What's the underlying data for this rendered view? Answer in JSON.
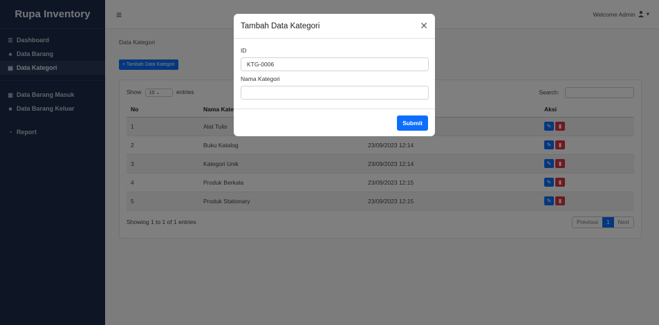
{
  "app": {
    "title": "Rupa Inventory"
  },
  "sidebar": {
    "items": [
      {
        "label": "Dashboard",
        "icon": "dashboard-icon"
      },
      {
        "label": "Data Barang",
        "icon": "boxes-icon"
      },
      {
        "label": "Data Kategori",
        "icon": "category-icon",
        "active": true
      },
      {
        "label": "Data Barang Masuk",
        "icon": "incoming-icon"
      },
      {
        "label": "Data Barang Keluar",
        "icon": "truck-icon"
      },
      {
        "label": "Report",
        "icon": "chart-icon"
      }
    ]
  },
  "topbar": {
    "welcome": "Welcome Admin"
  },
  "page": {
    "breadcrumb": "Data Kategori",
    "add_button": "+ Tambah Data Kategori"
  },
  "table": {
    "show_label": "Show",
    "show_value": "10",
    "entries_label": "entries",
    "search_label": "Search:",
    "headers": {
      "no": "No",
      "nama": "Nama Kategori",
      "tanggal": "",
      "aksi": "Aksi"
    },
    "rows": [
      {
        "no": "1",
        "nama": "Alat Tulis",
        "tanggal": ""
      },
      {
        "no": "2",
        "nama": "Buku Katalog",
        "tanggal": "23/09/2023 12:14"
      },
      {
        "no": "3",
        "nama": "Kategori Unik",
        "tanggal": "23/09/2023 12:14"
      },
      {
        "no": "4",
        "nama": "Produk Berkala",
        "tanggal": "23/09/2023 12:15"
      },
      {
        "no": "5",
        "nama": "Produk Stationary",
        "tanggal": "23/09/2023 12:15"
      }
    ],
    "info": "Showing 1 to 1 of 1 entries",
    "pager": {
      "prev": "Previous",
      "current": "1",
      "next": "Next"
    }
  },
  "modal": {
    "title": "Tambah Data Kategori",
    "id_label": "ID",
    "id_value": "KTG-0006",
    "nama_label": "Nama Kategori",
    "nama_value": "",
    "submit": "Submit"
  },
  "colors": {
    "sidebar": "#1c2a48",
    "primary": "#0d6efd",
    "danger": "#dc3545"
  }
}
